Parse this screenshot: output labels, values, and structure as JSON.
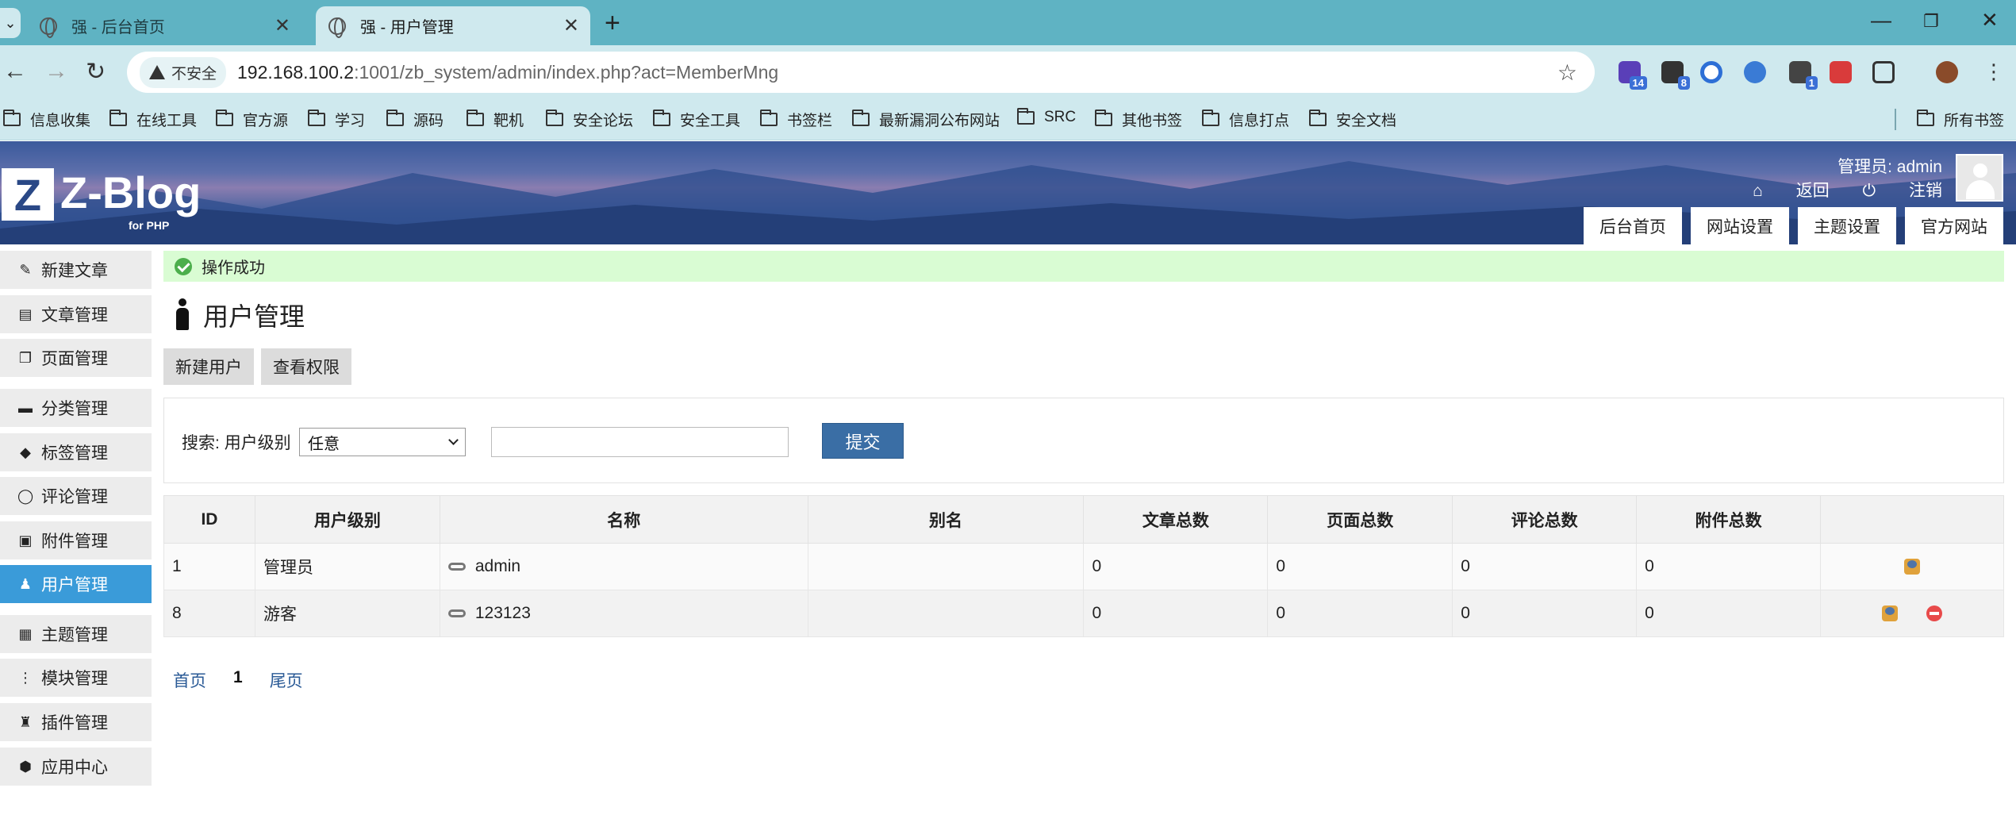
{
  "browser": {
    "tabs": [
      {
        "title": "强 - 后台首页"
      },
      {
        "title": "强 - 用户管理"
      }
    ],
    "security_label": "不安全",
    "url_host": "192.168.100.2",
    "url_rest": ":1001/zb_system/admin/index.php?act=MemberMng",
    "extension_badges": [
      "14",
      "8",
      "1"
    ],
    "bookmarks": [
      "信息收集",
      "在线工具",
      "官方源",
      "学习",
      "源码",
      "靶机",
      "安全论坛",
      "安全工具",
      "书签栏",
      "最新漏洞公布网站",
      "SRC",
      "其他书签",
      "信息打点",
      "安全文档"
    ],
    "all_bookmarks": "所有书签"
  },
  "header": {
    "logo_text": "Z-Blog",
    "logo_sub": "for PHP",
    "user_label": "管理员: admin",
    "back_link": "返回",
    "logout_link": "注销",
    "topnav": [
      "后台首页",
      "网站设置",
      "主题设置",
      "官方网站"
    ]
  },
  "sidebar": {
    "items": [
      {
        "label": "新建文章",
        "icon": "edit-icon"
      },
      {
        "label": "文章管理",
        "icon": "article-icon"
      },
      {
        "label": "页面管理",
        "icon": "page-icon"
      },
      {
        "label": "分类管理",
        "icon": "folder-icon"
      },
      {
        "label": "标签管理",
        "icon": "tag-icon"
      },
      {
        "label": "评论管理",
        "icon": "comment-icon"
      },
      {
        "label": "附件管理",
        "icon": "attachment-icon"
      },
      {
        "label": "用户管理",
        "icon": "user-icon"
      },
      {
        "label": "主题管理",
        "icon": "theme-icon"
      },
      {
        "label": "模块管理",
        "icon": "module-icon"
      },
      {
        "label": "插件管理",
        "icon": "plugin-icon"
      },
      {
        "label": "应用中心",
        "icon": "app-center-icon"
      }
    ],
    "active": "用户管理"
  },
  "main": {
    "notice": "操作成功",
    "title": "用户管理",
    "actions": [
      "新建用户",
      "查看权限"
    ],
    "search": {
      "label": "搜索:",
      "level_label": "用户级别",
      "level_value": "任意",
      "input_value": "",
      "submit": "提交"
    },
    "table": {
      "headers": [
        "ID",
        "用户级别",
        "名称",
        "别名",
        "文章总数",
        "页面总数",
        "评论总数",
        "附件总数",
        ""
      ],
      "rows": [
        {
          "id": "1",
          "level": "管理员",
          "name": "admin",
          "alias": "",
          "articles": "0",
          "pages": "0",
          "comments": "0",
          "attachments": "0"
        },
        {
          "id": "8",
          "level": "游客",
          "name": "123123",
          "alias": "",
          "articles": "0",
          "pages": "0",
          "comments": "0",
          "attachments": "0"
        }
      ]
    },
    "pager": {
      "first": "首页",
      "current": "1",
      "last": "尾页"
    }
  }
}
